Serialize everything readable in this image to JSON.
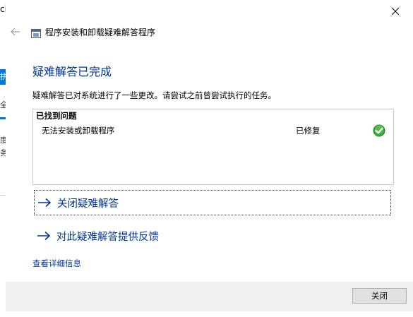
{
  "background_window": {
    "title_fragment": "ci",
    "accent_fragment": "拼",
    "line1_fragment": "全之",
    "line2_fragment": "度",
    "line3_fragment": "务"
  },
  "dialog": {
    "header_title": "程序安装和卸载疑难解答程序",
    "heading": "疑难解答已完成",
    "description": "疑难解答已对系统进行了一些更改。请尝试之前曾尝试执行的任务。",
    "problems": {
      "header": "已找到问题",
      "items": [
        {
          "name": "无法安装或卸载程序",
          "status": "已修复",
          "status_color": "#2e9e2e"
        }
      ]
    },
    "actions": [
      {
        "label": "关闭疑难解答",
        "icon": "arrow-right-icon"
      },
      {
        "label": "对此疑难解答提供反馈",
        "icon": "arrow-right-icon"
      }
    ],
    "details_link": "查看详细信息",
    "close_button": "关闭"
  },
  "colors": {
    "heading_blue": "#003399",
    "link_blue": "#003399",
    "accent_blue": "#0078d7",
    "footer_bg": "#f0f0f0",
    "success_green": "#2e9e2e"
  }
}
